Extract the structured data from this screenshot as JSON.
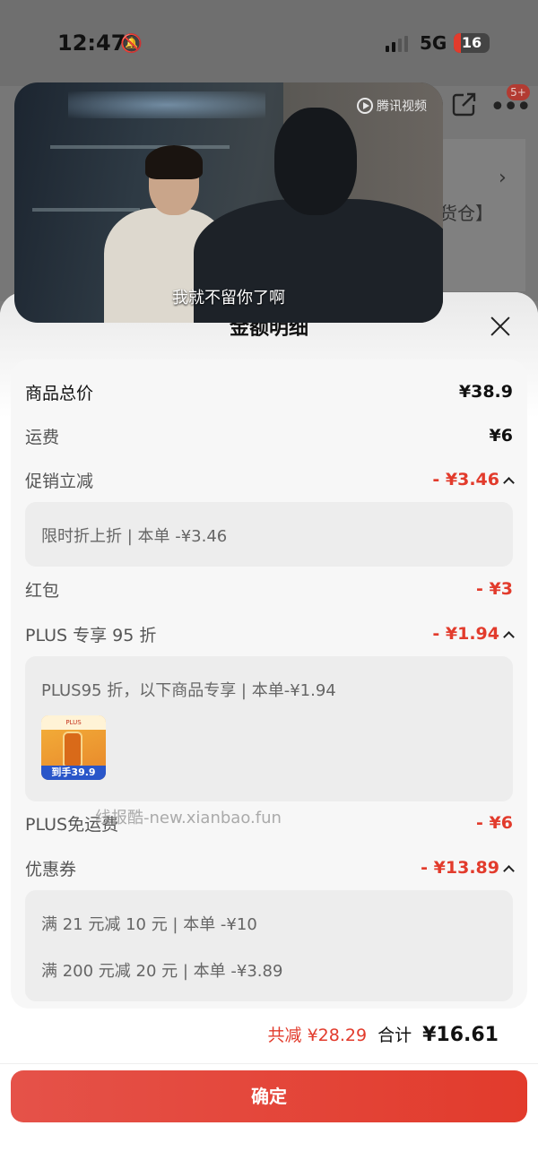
{
  "status_bar": {
    "time": "12:47",
    "network": "5G",
    "battery": "16"
  },
  "background": {
    "more_badge": "5+",
    "peek_text": "货仓】"
  },
  "video": {
    "brand": "腾讯视频",
    "subtitle": "我就不留你了啊"
  },
  "sheet": {
    "title": "金额明细",
    "rows": {
      "total": {
        "label": "商品总价",
        "value": "¥38.9"
      },
      "shipping": {
        "label": "运费",
        "value": "¥6"
      },
      "promo": {
        "label": "促销立减",
        "value": "- ¥3.46",
        "detail": "限时折上折 | 本单 -¥3.46"
      },
      "red_packet": {
        "label": "红包",
        "value": "- ¥3"
      },
      "plus95": {
        "label": "PLUS 专享 95 折",
        "value": "- ¥1.94",
        "detail": "PLUS95 折，以下商品专享 | 本单-¥1.94",
        "thumb_price": "到手39.9"
      },
      "plus_free_ship": {
        "label": "PLUS免运费",
        "value": "- ¥6"
      },
      "coupon": {
        "label": "优惠券",
        "value": "- ¥13.89",
        "detail_1": "满 21 元减 10 元 | 本单 -¥10",
        "detail_2": "满 200 元减 20 元 | 本单 -¥3.89"
      }
    },
    "watermark": "线报酷-new.xianbao.fun",
    "saved": "共减 ¥28.29",
    "total_label": "合计",
    "total_value": "¥16.61",
    "confirm": "确定"
  },
  "colors": {
    "accent": "#e23b2c"
  },
  "icons": [
    "bell-mute-icon",
    "share-icon",
    "more-icon",
    "close-icon",
    "chevron-up-icon",
    "tencent-video-icon"
  ]
}
